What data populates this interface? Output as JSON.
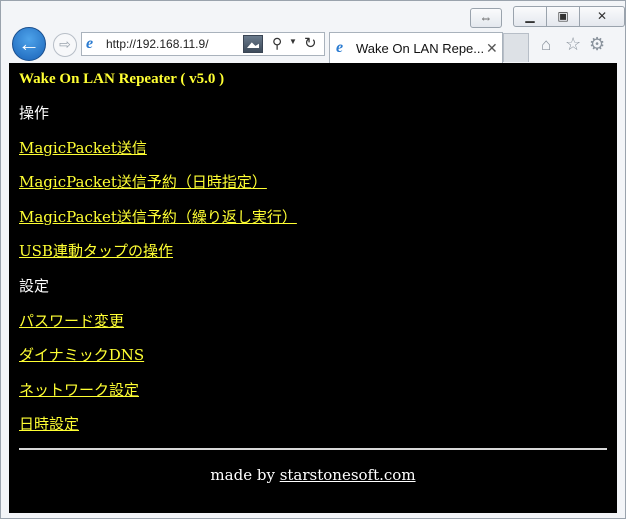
{
  "browser": {
    "address": "http://192.168.11.9/",
    "tab_title": "Wake On LAN Repe...",
    "icons": {
      "back": "back-arrow-icon",
      "forward": "forward-arrow-icon",
      "site": "ie-logo-icon",
      "compat": "compatibility-view-icon",
      "search": "search-icon",
      "refresh": "refresh-icon",
      "close_tab": "close-icon",
      "home": "home-icon",
      "favorites": "star-icon",
      "tools": "gear-icon",
      "pin": "pin-icon",
      "minimize": "minimize-icon",
      "restore": "restore-icon",
      "close_window": "close-icon"
    }
  },
  "page": {
    "heading": "Wake On LAN Repeater ( v5.0 )",
    "sections": [
      {
        "title": "操作",
        "links": [
          "MagicPacket送信",
          "MagicPacket送信予約（日時指定）",
          "MagicPacket送信予約（繰り返し実行）",
          "USB連動タップの操作"
        ]
      },
      {
        "title": "設定",
        "links": [
          "パスワード変更",
          "ダイナミックDNS",
          "ネットワーク設定",
          "日時設定"
        ]
      }
    ],
    "footer_prefix": "made by ",
    "footer_link": "starstonesoft.com",
    "colors": {
      "background": "#000000",
      "link": "#ffff33",
      "text": "#ffffff"
    }
  }
}
